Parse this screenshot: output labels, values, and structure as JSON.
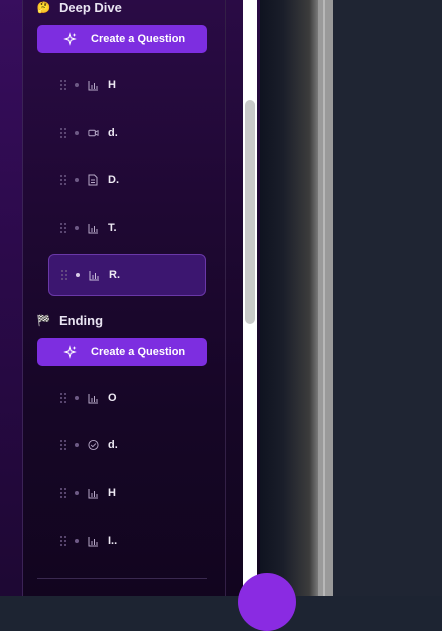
{
  "sections": [
    {
      "emoji": "🤔",
      "title": "Deep Dive",
      "create_label": "Create a Question",
      "questions": [
        {
          "title": "H",
          "icon": "chart-icon",
          "selected": false
        },
        {
          "title": "d.",
          "icon": "video-icon",
          "selected": false
        },
        {
          "title": "D.",
          "icon": "document-icon",
          "selected": false
        },
        {
          "title": "T.",
          "icon": "chart-icon",
          "selected": false
        },
        {
          "title": "R.",
          "icon": "chart-icon",
          "selected": true
        }
      ]
    },
    {
      "emoji": "🏁",
      "title": "Ending",
      "create_label": "Create a Question",
      "questions": [
        {
          "title": "O",
          "icon": "chart-icon",
          "selected": false
        },
        {
          "title": "d.",
          "icon": "check-circle-icon",
          "selected": false
        },
        {
          "title": "H",
          "icon": "chart-icon",
          "selected": false
        },
        {
          "title": "I..",
          "icon": "chart-icon",
          "selected": false
        }
      ]
    }
  ],
  "colors": {
    "accent": "#7d2ee0",
    "sidebar_bg": "#1f0833",
    "selected_bg": "#3c1670"
  }
}
